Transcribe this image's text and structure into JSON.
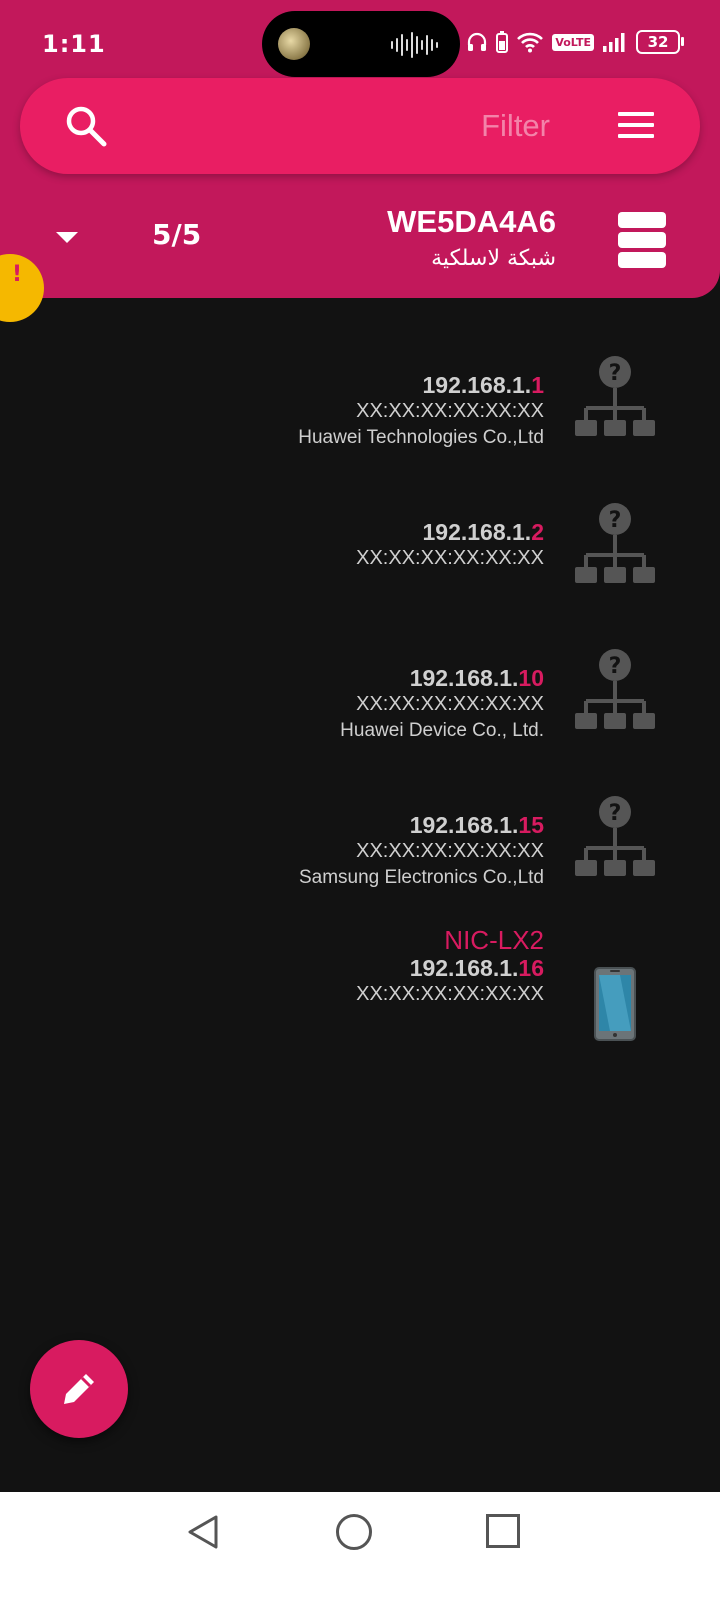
{
  "status_bar": {
    "time": "1:11",
    "battery": "32",
    "volte": "VoLTE"
  },
  "search": {
    "placeholder": "Filter"
  },
  "network": {
    "count": "5/5",
    "ssid": "WE5DA4A6",
    "subtitle": "شبكة لاسلكية",
    "warning_badge": "!"
  },
  "devices": [
    {
      "ip_prefix": "192.168.1.",
      "ip_last": "1",
      "mac": "XX:XX:XX:XX:XX:XX",
      "vendor": "Huawei Technologies Co.,Ltd",
      "icon": "unknown-network-icon"
    },
    {
      "ip_prefix": "192.168.1.",
      "ip_last": "2",
      "mac": "XX:XX:XX:XX:XX:XX",
      "vendor": "",
      "icon": "unknown-network-icon"
    },
    {
      "ip_prefix": "192.168.1.",
      "ip_last": "10",
      "mac": "XX:XX:XX:XX:XX:XX",
      "vendor": "Huawei Device Co., Ltd.",
      "icon": "unknown-network-icon"
    },
    {
      "ip_prefix": "192.168.1.",
      "ip_last": "15",
      "mac": "XX:XX:XX:XX:XX:XX",
      "vendor": "Samsung Electronics Co.,Ltd",
      "icon": "unknown-network-icon"
    },
    {
      "name": "NIC-LX2",
      "ip_prefix": "192.168.1.",
      "ip_last": "16",
      "mac": "XX:XX:XX:XX:XX:XX",
      "icon": "smartphone-icon"
    }
  ],
  "colors": {
    "header": "#c2185b",
    "search": "#e91e63",
    "accent": "#d81b60",
    "background": "#121212"
  }
}
